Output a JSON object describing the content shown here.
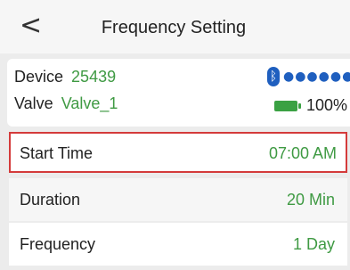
{
  "header": {
    "back_glyph": "<",
    "title": "Frequency Setting"
  },
  "device_card": {
    "device_label": "Device",
    "device_value": "25439",
    "valve_label": "Valve",
    "valve_value": "Valve_1",
    "bluetooth_glyph": "ᛒ",
    "signal_dots": "●●●●●●",
    "battery_percent": "100%",
    "battery_level": 1.0
  },
  "settings": [
    {
      "label": "Start Time",
      "value": "07:00 AM"
    },
    {
      "label": "Duration",
      "value": "20 Min"
    },
    {
      "label": "Frequency",
      "value": "1 Day"
    }
  ],
  "colors": {
    "accent_green": "#3f9a43",
    "bluetooth_blue": "#1f5fbf",
    "highlight_red": "#d43b3b"
  }
}
